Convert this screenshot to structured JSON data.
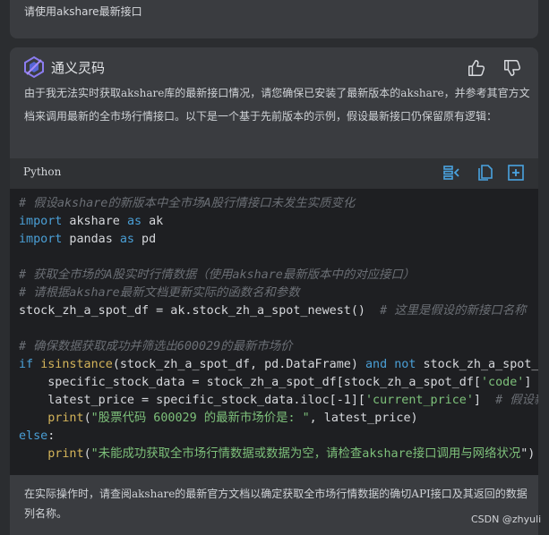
{
  "user_message": "请使用akshare最新接口",
  "assistant": {
    "name": "通义灵码",
    "intro": "由于我无法实时获取akshare库的最新接口情况，请您确保已安装了最新版本的akshare，并参考其官方文档来调用最新的全市场行情接口。以下是一个基于先前版本的示例，假设最新接口仍保留原有逻辑：",
    "code": {
      "language": "Python",
      "lines": {
        "l1": "# 假设akshare的新版本中全市场A股行情接口未发生实质变化",
        "l2_kw1": "import",
        "l2_mod": " akshare ",
        "l2_kw2": "as",
        "l2_alias": " ak",
        "l3_kw1": "import",
        "l3_mod": " pandas ",
        "l3_kw2": "as",
        "l3_alias": " pd",
        "l5": "# 获取全市场的A股实时行情数据（使用akshare最新版本中的对应接口）",
        "l6": "# 请根据akshare最新文档更新实际的函数名和参数",
        "l7_code": "stock_zh_a_spot_df = ak.stock_zh_a_spot_newest()  ",
        "l7_cm": "# 这里是假设的新接口名称",
        "l9": "# 确保数据获取成功并筛选出600029的最新市场价",
        "l10_kw": "if",
        "l10_sp": " ",
        "l10_bi": "isinstance",
        "l10_code": "(stock_zh_a_spot_df, pd.DataFrame) ",
        "l10_and": "and",
        "l10_sp2": " ",
        "l10_not": "not",
        "l10_rest": " stock_zh_a_spot_df.empty:",
        "l11_code": "    specific_stock_data = stock_zh_a_spot_df[stock_zh_a_spot_df[",
        "l11_str": "'code'",
        "l11_rest": "] == ",
        "l12_code": "    latest_price = specific_stock_data.iloc[-1][",
        "l12_str": "'current_price'",
        "l12_mid": "]  ",
        "l12_cm": "# 假设新接口中当前价格字段名为current_price",
        "l13_ind": "    ",
        "l13_bi": "print",
        "l13_p": "(",
        "l13_str": "\"股票代码 600029 的最新市场价是: \"",
        "l13_rest": ", latest_price)",
        "l14_kw": "else",
        "l14_rest": ":",
        "l15_ind": "    ",
        "l15_bi": "print",
        "l15_p": "(",
        "l15_str": "\"未能成功获取全市场行情数据或数据为空，请检查akshare接口调用与网络状况",
        "l15_rest": "\")"
      }
    },
    "outro": "在实际操作时，请查阅akshare的最新官方文档以确定获取全市场行情数据的确切API接口及其返回的数据列名称。"
  },
  "watermark": "CSDN @zhyuli",
  "colors": {
    "background": "#2b2d30",
    "card": "#3a3c40",
    "code_bg": "#1e1f22",
    "keyword": "#4a9fd6",
    "builtin": "#d4b45a",
    "string": "#7dc07a",
    "comment": "#6b6f75",
    "accent_icon": "#4aa3e0"
  },
  "icons": {
    "logo": "tongyi-logo-icon",
    "thumb_up": "thumbs-up-icon",
    "thumb_down": "thumbs-down-icon",
    "insert": "insert-code-icon",
    "copy": "copy-icon",
    "new_file": "new-file-icon"
  }
}
